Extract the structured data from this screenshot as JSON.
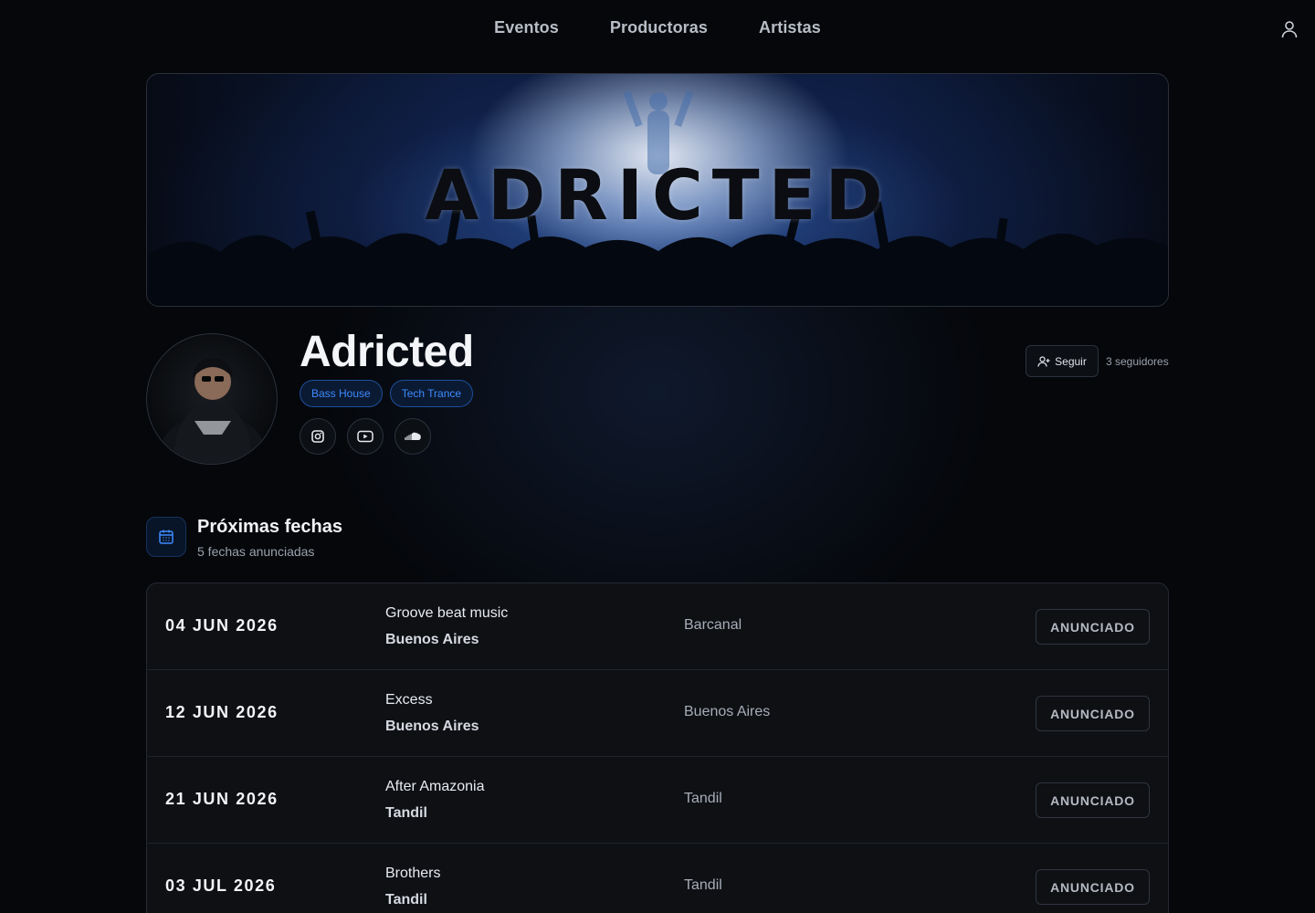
{
  "nav": {
    "links": [
      "Eventos",
      "Productoras",
      "Artistas"
    ]
  },
  "banner": {
    "logo_text": "ADRICTED"
  },
  "artist": {
    "name": "Adricted",
    "genres": [
      "Bass House",
      "Tech Trance"
    ],
    "socials": [
      "instagram-icon",
      "youtube-icon",
      "soundcloud-icon"
    ],
    "follow_label": "Seguir",
    "followers_text": "3 seguidores"
  },
  "upcoming": {
    "title": "Próximas fechas",
    "subtitle": "5 fechas anunciadas",
    "events": [
      {
        "date": "04 JUN 2026",
        "name": "Groove beat music",
        "city": "Buenos Aires",
        "venue": "Barcanal",
        "status": "ANUNCIADO"
      },
      {
        "date": "12 JUN 2026",
        "name": "Excess",
        "city": "Buenos Aires",
        "venue": "Buenos Aires",
        "status": "ANUNCIADO"
      },
      {
        "date": "21 JUN 2026",
        "name": "After Amazonia",
        "city": "Tandil",
        "venue": "Tandil",
        "status": "ANUNCIADO"
      },
      {
        "date": "03 JUL 2026",
        "name": "Brothers",
        "city": "Tandil",
        "venue": "Tandil",
        "status": "ANUNCIADO"
      }
    ]
  },
  "colors": {
    "accent": "#3d8bff",
    "background": "#05070b",
    "card": "#0e1014"
  }
}
